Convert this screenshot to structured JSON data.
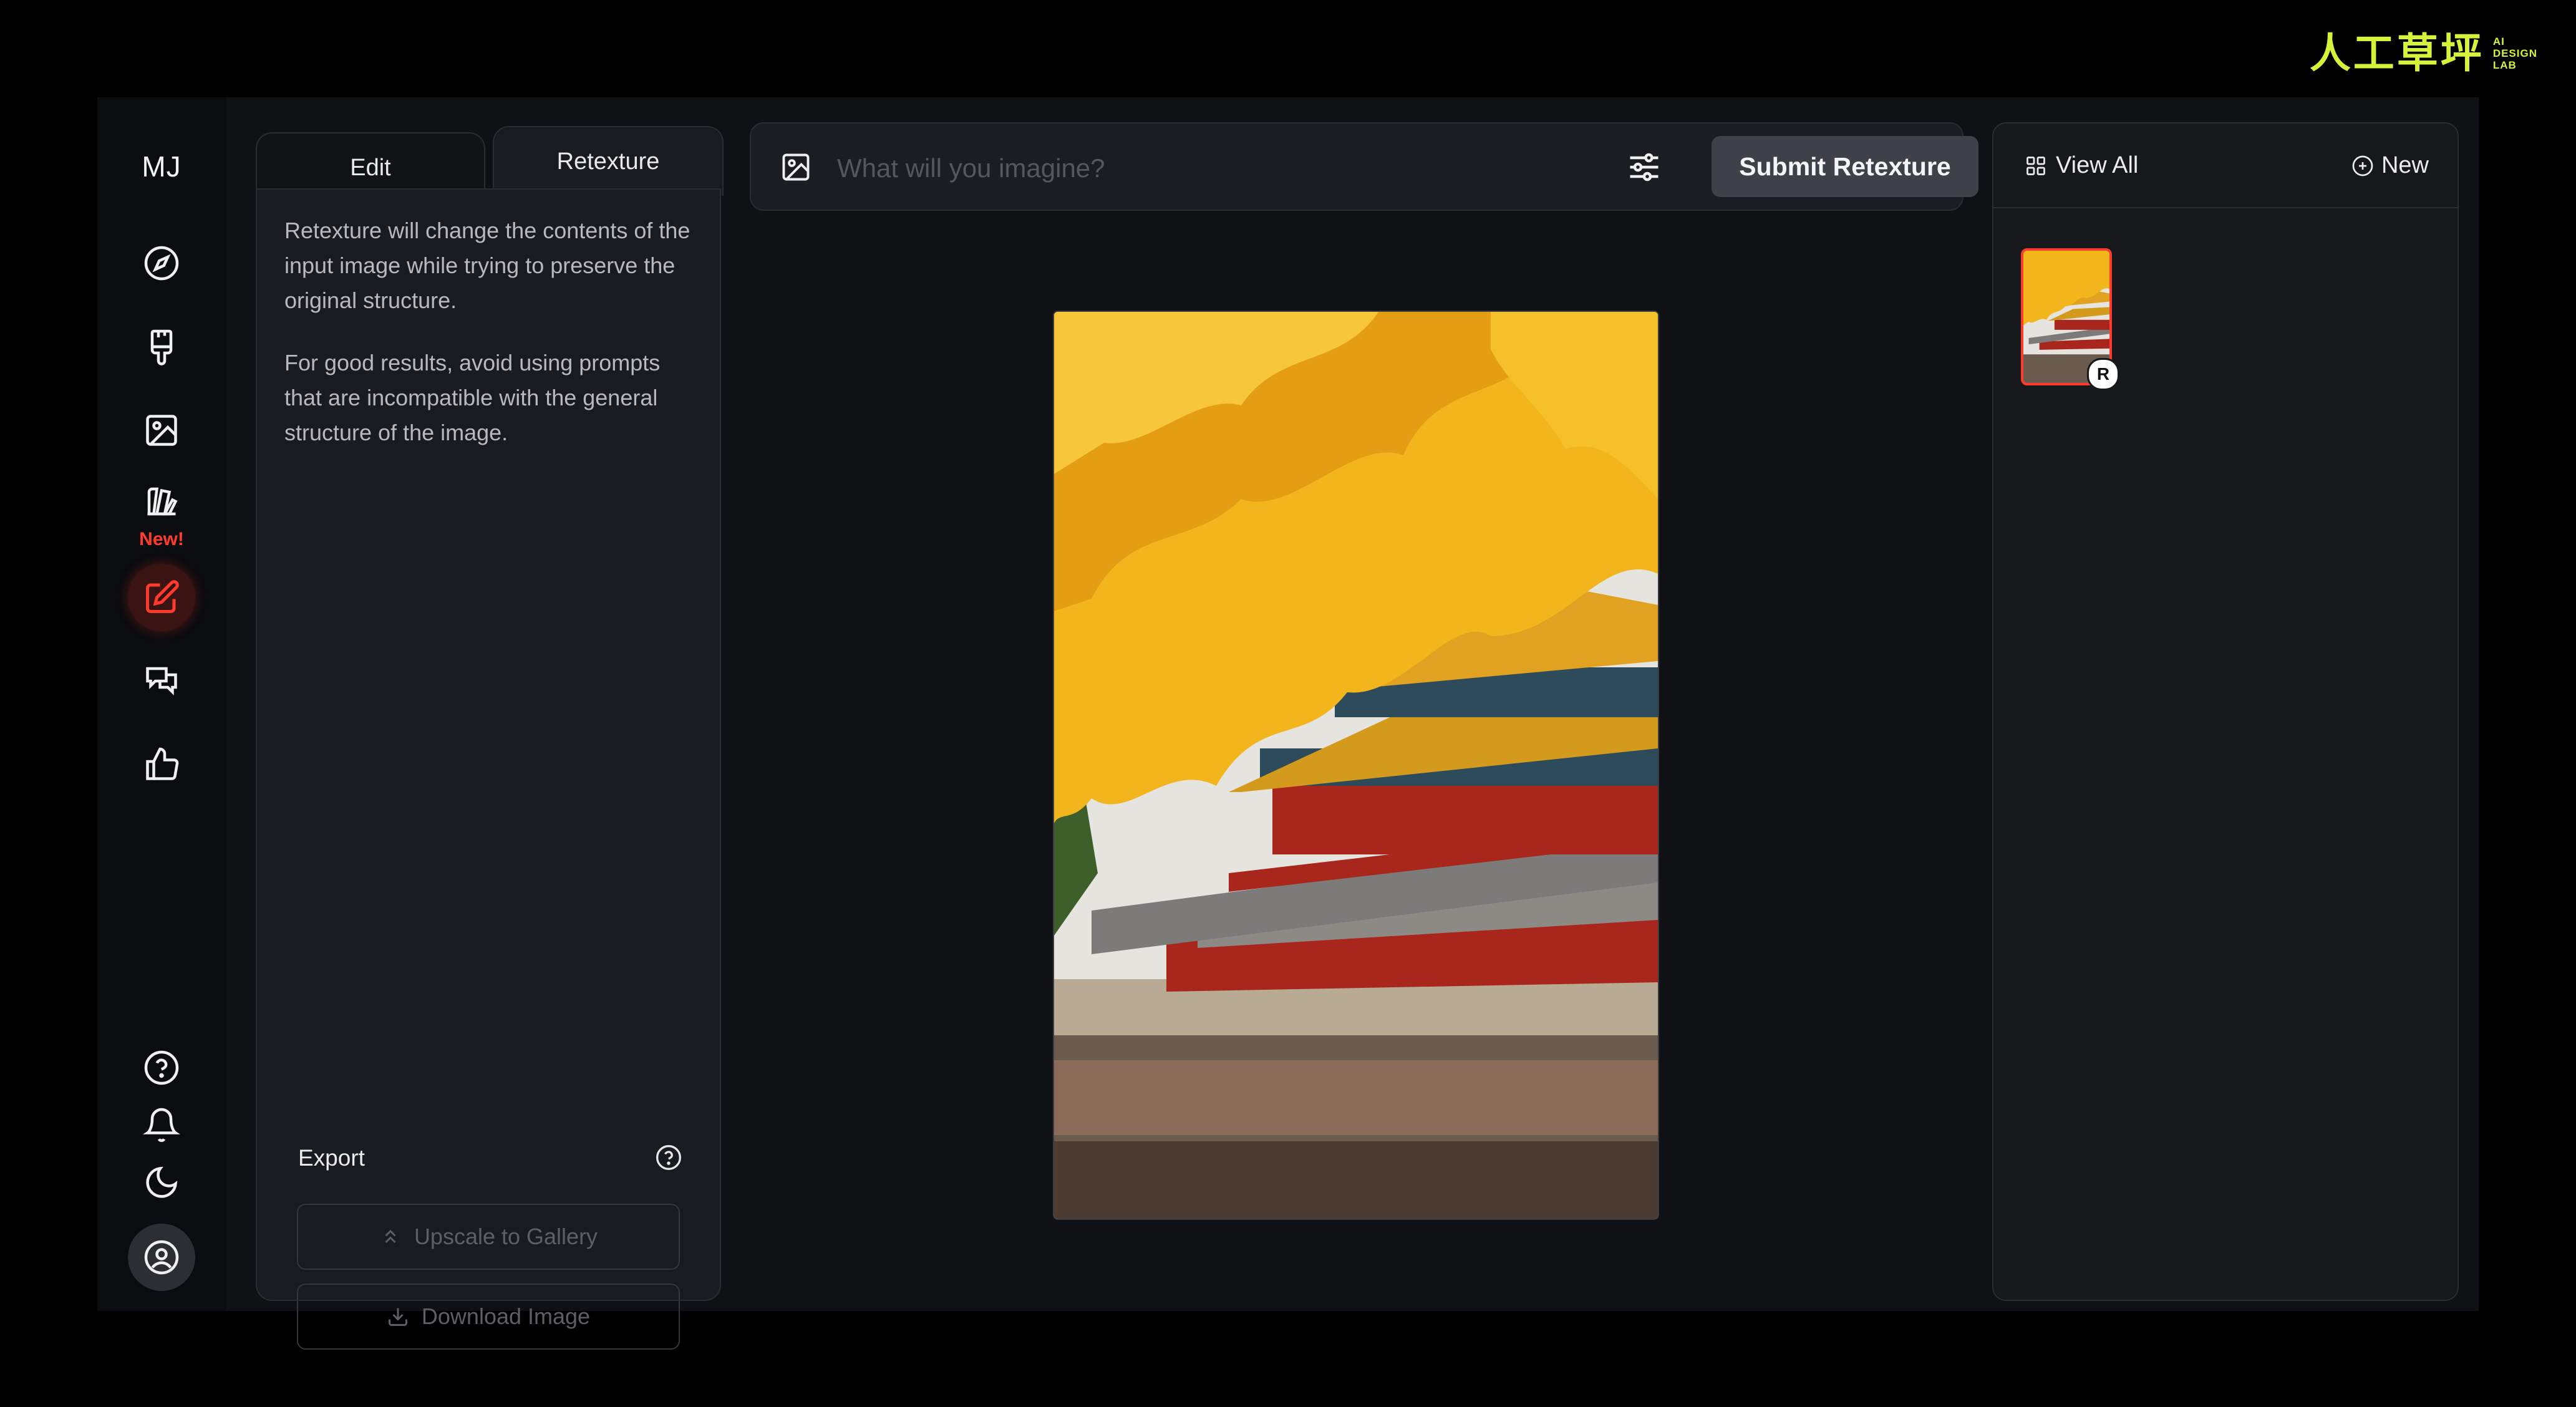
{
  "brand": {
    "cn_text": "人工草坪",
    "en_text": "AI DESIGN LAB",
    "color": "#d7f23a"
  },
  "sidebar": {
    "logo": "MJ",
    "new_badge": "New!",
    "items": [
      {
        "icon": "compass-icon"
      },
      {
        "icon": "paintbrush-icon"
      },
      {
        "icon": "image-icon"
      },
      {
        "icon": "palette-icon"
      },
      {
        "icon": "edit-icon",
        "active": true
      },
      {
        "icon": "chat-icon"
      },
      {
        "icon": "thumbs-up-icon"
      }
    ],
    "bottom_items": [
      {
        "icon": "help-icon"
      },
      {
        "icon": "bell-icon"
      },
      {
        "icon": "moon-icon"
      },
      {
        "icon": "user-icon"
      }
    ]
  },
  "tool_panel": {
    "tabs": [
      {
        "label": "Edit"
      },
      {
        "label": "Retexture",
        "active": true
      }
    ],
    "description_1": "Retexture will change the contents of the input image while trying to preserve the original structure.",
    "description_2": "For good results, avoid using prompts that are incompatible with the general structure of the image.",
    "export": {
      "label": "Export",
      "upscale_label": "Upscale to Gallery",
      "download_label": "Download Image"
    }
  },
  "prompt_bar": {
    "placeholder": "What will you imagine?",
    "value": "",
    "submit_label": "Submit Retexture"
  },
  "gallery": {
    "view_all_label": "View All",
    "new_label": "New",
    "thumb_badge": "R"
  },
  "colors": {
    "accent": "#ff3b2e",
    "panel": "#1a1b20",
    "background": "#000000"
  }
}
